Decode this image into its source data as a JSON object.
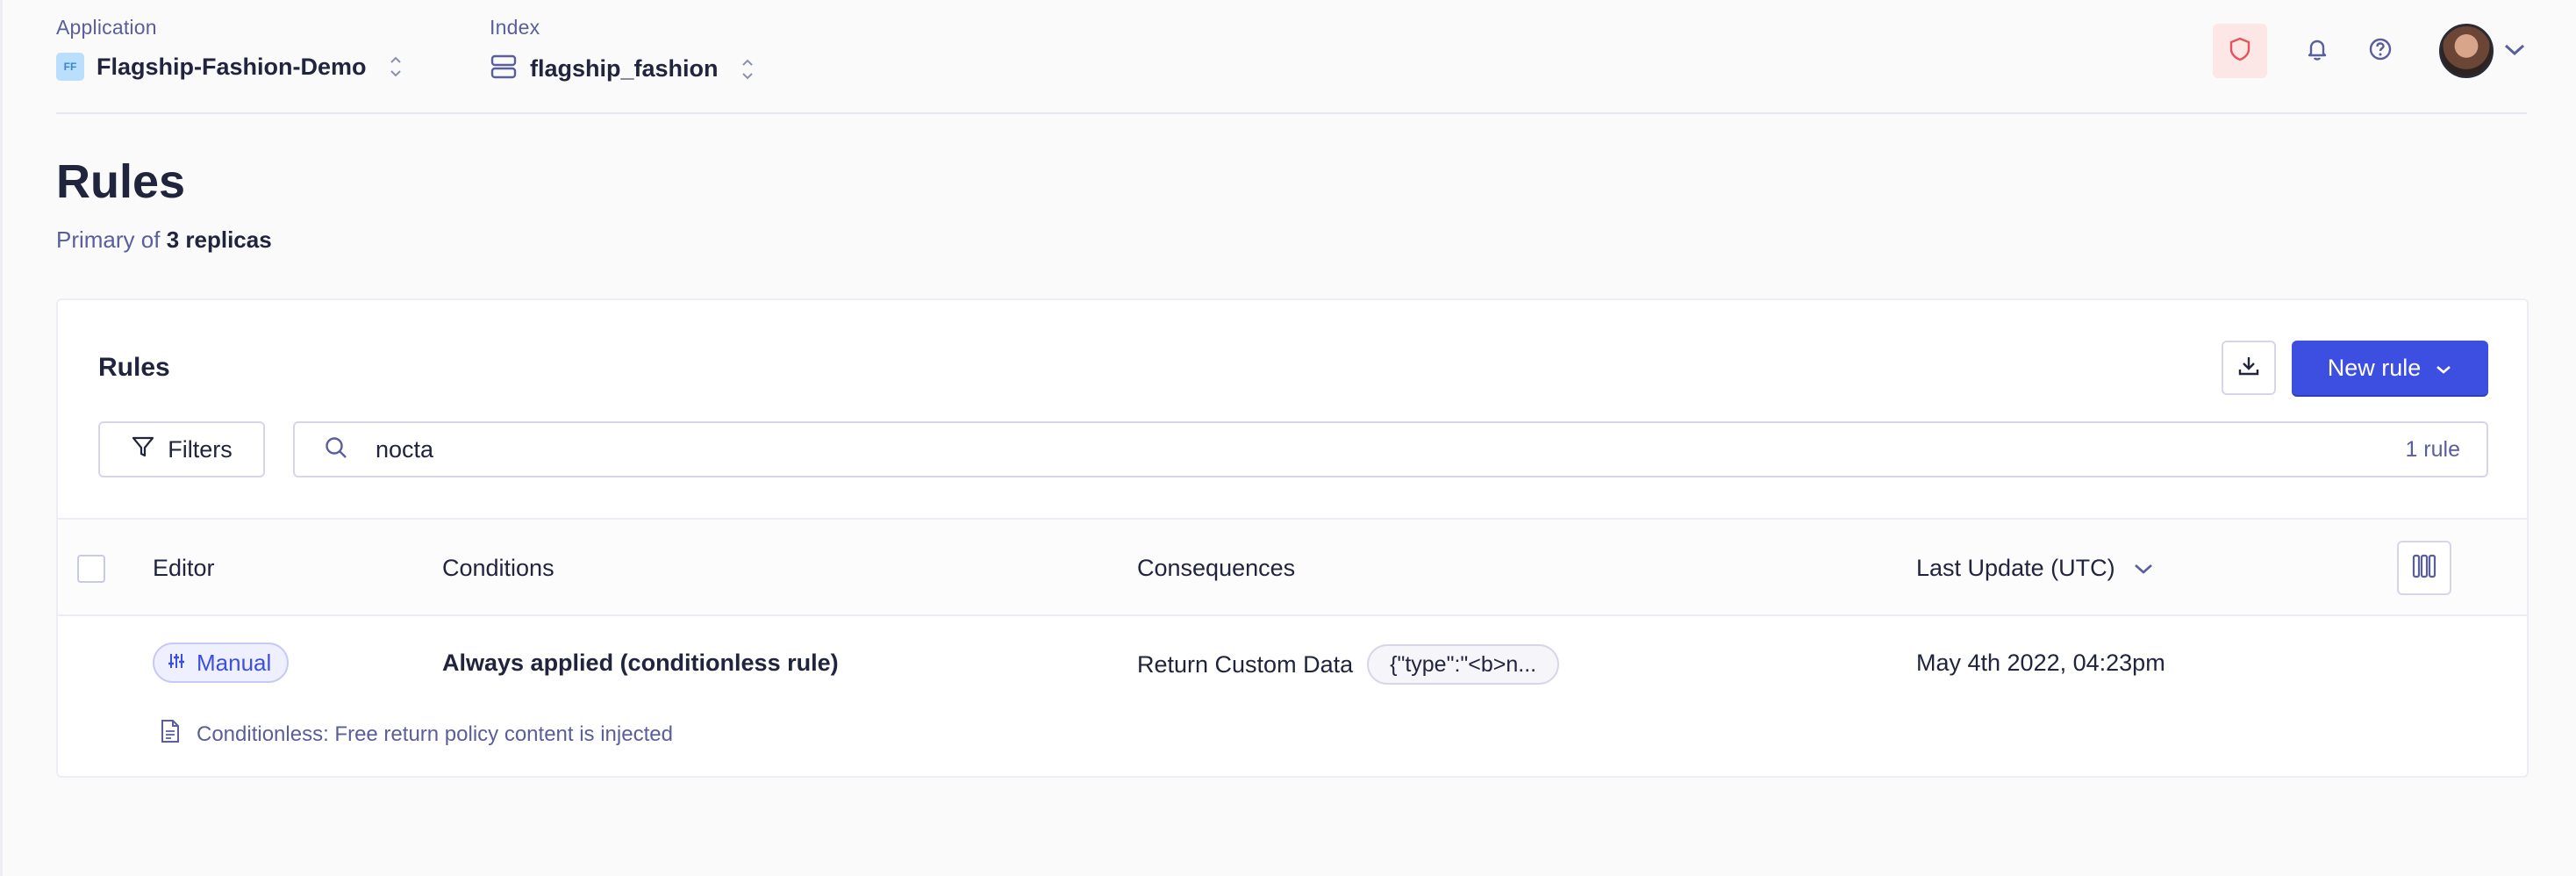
{
  "header": {
    "application": {
      "label": "Application",
      "badge": "FF",
      "value": "Flagship-Fashion-Demo"
    },
    "index": {
      "label": "Index",
      "value": "flagship_fashion"
    }
  },
  "page": {
    "title": "Rules",
    "subtitle_prefix": "Primary of",
    "subtitle_strong": "3 replicas"
  },
  "card": {
    "title": "Rules",
    "new_rule_label": "New rule",
    "filters_label": "Filters",
    "search_value": "nocta",
    "result_count": "1 rule"
  },
  "table": {
    "columns": {
      "editor": "Editor",
      "conditions": "Conditions",
      "consequences": "Consequences",
      "last_update": "Last Update (UTC)"
    },
    "rows": [
      {
        "editor": "Manual",
        "conditions": "Always applied (conditionless rule)",
        "consequence": "Return Custom Data",
        "consequence_value": "{\"type\":\"<b>n...",
        "last_update": "May 4th 2022, 04:23pm",
        "description": "Conditionless: Free return policy content is injected"
      }
    ]
  },
  "colors": {
    "accent": "#3c4fe0",
    "text": "#21243d",
    "muted": "#5a5e9a",
    "warning_bg": "#fde6e6"
  }
}
